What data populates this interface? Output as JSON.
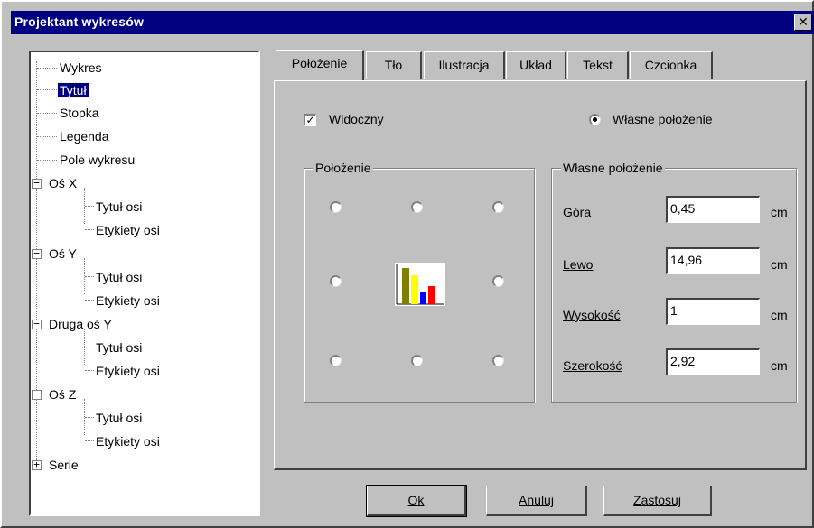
{
  "window": {
    "title": "Projektant wykresów",
    "close_symbol": "✕"
  },
  "tree": {
    "items": [
      {
        "label": "Wykres"
      },
      {
        "label": "Tytuł",
        "selected": true
      },
      {
        "label": "Stopka"
      },
      {
        "label": "Legenda"
      },
      {
        "label": "Pole wykresu"
      },
      {
        "label": "Oś X",
        "expander": "−"
      },
      {
        "label": "Tytuł osi"
      },
      {
        "label": "Etykiety osi"
      },
      {
        "label": "Oś Y",
        "expander": "−"
      },
      {
        "label": "Tytuł osi"
      },
      {
        "label": "Etykiety osi"
      },
      {
        "label": "Druga oś Y",
        "expander": "−"
      },
      {
        "label": "Tytuł osi"
      },
      {
        "label": "Etykiety osi"
      },
      {
        "label": "Oś Z",
        "expander": "−"
      },
      {
        "label": "Tytuł osi"
      },
      {
        "label": "Etykiety osi"
      },
      {
        "label": "Serie",
        "expander": "+"
      }
    ]
  },
  "tabs": [
    {
      "label": "Położenie",
      "active": true
    },
    {
      "label": "Tło"
    },
    {
      "label": "Ilustracja"
    },
    {
      "label": "Układ"
    },
    {
      "label": "Tekst"
    },
    {
      "label": "Czcionka"
    }
  ],
  "panel": {
    "visible_label": "Widoczny",
    "visible_checked": true,
    "custom_position_radio_label": "Własne położenie",
    "custom_position_radio_checked": true,
    "position_group_title": "Położenie",
    "custom_group_title": "Własne położenie",
    "fields": [
      {
        "label": "Góra",
        "value": "0,45",
        "unit": "cm"
      },
      {
        "label": "Lewo",
        "value": "14,96",
        "unit": "cm"
      },
      {
        "label": "Wysokość",
        "value": "1",
        "unit": "cm"
      },
      {
        "label": "Szerokość",
        "value": "2,92",
        "unit": "cm"
      }
    ],
    "chart_icon_colors": [
      "#808000",
      "#ffff00",
      "#0000ff",
      "#ff0000"
    ]
  },
  "buttons": {
    "ok": "Ok",
    "cancel": "Anuluj",
    "apply": "Zastosuj"
  }
}
